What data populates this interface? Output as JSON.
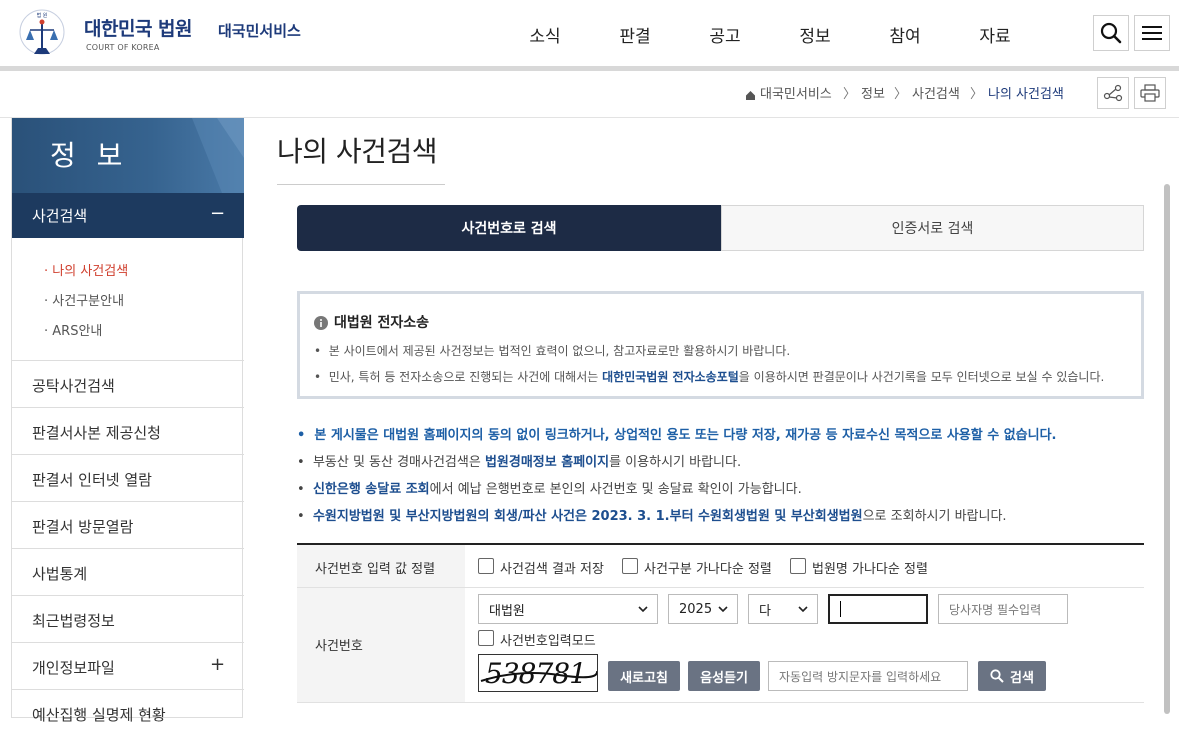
{
  "header": {
    "logo_title": "대한민국 법원",
    "logo_sub": "COURT OF KOREA",
    "service": "대국민서비스",
    "nav": [
      "소식",
      "판결",
      "공고",
      "정보",
      "참여",
      "자료"
    ],
    "icons": [
      "search-icon",
      "menu-icon"
    ]
  },
  "breadcrumb": {
    "items": [
      "대국민서비스",
      "정보",
      "사건검색",
      "나의 사건검색"
    ],
    "home_icon": "home-icon",
    "tools": [
      "share-icon",
      "print-icon"
    ]
  },
  "sidebar": {
    "title": "정 보",
    "active_section": "사건검색",
    "active_toggle": "−",
    "subitems": [
      "나의 사건검색",
      "사건구분안내",
      "ARS안내"
    ],
    "items": [
      "공탁사건검색",
      "판결서사본 제공신청",
      "판결서 인터넷 열람",
      "판결서 방문열람",
      "사법통계",
      "최근법령정보",
      "개인정보파일",
      "예산집행 실명제 현황"
    ],
    "expand_toggle": "+"
  },
  "main": {
    "title": "나의 사건검색",
    "tabs": [
      "사건번호로 검색",
      "인증서로 검색"
    ],
    "notice": {
      "title": "대법원 전자소송",
      "line1": "본 사이트에서 제공된 사건정보는 법적인 효력이 없으니, 참고자료로만 활용하시기 바랍니다.",
      "line2_pre": "민사, 특허 등 전자소송으로 진행되는 사건에 대해서는 ",
      "line2_link": "대한민국법원 전자소송포털",
      "line2_post": "을 이용하시면 판결문이나 사건기록을 모두 인터넷으로 보실 수 있습니다."
    },
    "bullets": {
      "b1": "본 게시물은 대법원 홈페이지의 동의 없이 링크하거나, 상업적인 용도 또는 다량 저장, 재가공 등 자료수신 목적으로 사용할 수 없습니다.",
      "b2_pre": "부동산 및 동산 경매사건검색은 ",
      "b2_link": "법원경매정보 홈페이지",
      "b2_post": "를 이용하시기 바랍니다.",
      "b3_link": "신한은행 송달료 조회",
      "b3_post": "에서 예납 은행번호로 본인의 사건번호 및 송달료 확인이 가능합니다.",
      "b4_link": "수원지방법원 및 부산지방법원의 회생/파산 사건은 2023. 3. 1.부터 수원회생법원 및 부산회생법원",
      "b4_post": "으로 조회하시기 바랍니다."
    },
    "form": {
      "sort_label": "사건번호 입력 값 정렬",
      "sort_options": [
        "사건검색 결과 저장",
        "사건구분 가나다순 정렬",
        "법원명 가나다순 정렬"
      ],
      "case_label": "사건번호",
      "court": "대법원",
      "year": "2025",
      "case_type": "다",
      "case_number": "",
      "party_placeholder": "당사자명 필수입력",
      "input_mode": "사건번호입력모드",
      "captcha_text": "538781",
      "refresh": "새로고침",
      "audio": "음성듣기",
      "captcha_placeholder": "자동입력 방지문자를 입력하세요",
      "search": "검색"
    }
  }
}
